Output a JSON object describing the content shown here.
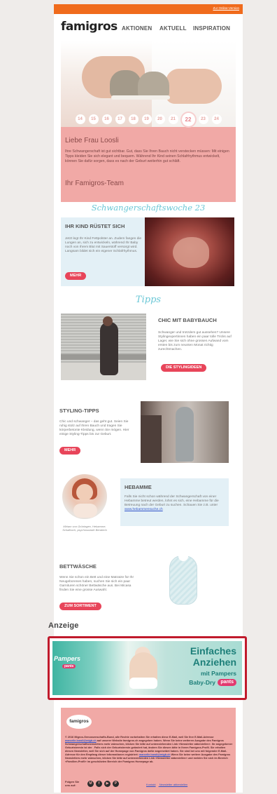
{
  "topbar": {
    "online_link": "Zur Online-Version"
  },
  "header": {
    "logo": "famigros",
    "nav": [
      "AKTIONEN",
      "AKTUELL",
      "INSPIRATION"
    ]
  },
  "hero": {
    "weeks": [
      "14",
      "15",
      "16",
      "17",
      "18",
      "19",
      "20",
      "21",
      "22",
      "23",
      "24"
    ],
    "greeting": "Liebe Frau Loosli",
    "text": "Ihre Schwangerschaft ist gut sichtbar. Gut, dass Sie Ihren Bauch nicht verstecken müssen: Mit einigen Tipps kleiden Sie sich elegant und bequem. Während Ihr Kind seinen Schlafrhythmus entwickelt, können Sie dafür sorgen, dass es nach der Geburt weiterhin gut schläft.",
    "signature": "Ihr Famigros-Team"
  },
  "week_heading": "Schwangerschaftswoche 23",
  "kind": {
    "title": "IHR KIND RÜSTET SICH",
    "text": "Jetzt legt Ihr Kind Fettpolster an. Zudem fangen die Lungen an, sich zu entwickeln, während Ihr Baby noch von Ihrem Blut mit Sauerstoff versorgt wird. Langsam bildet sich ein eigener Schlafrhythmus.",
    "button": "MEHR"
  },
  "tipps_heading": "Tipps",
  "chic": {
    "title": "CHIC MIT BABYBAUCH",
    "text": "Schwanger und trotzdem gut aussehen? Unsere Stylingexpertinnen haben ein paar tolle Tricks auf Lager, wie Sie sich ohne grossen Aufwand vom ersten bis zum neunten Monat richtig zurechtmachen.",
    "button": "DIE STYLINGIDEEN"
  },
  "styling": {
    "title": "STYLING-TIPPS",
    "text": "Chic und schwanger – das geht gut. Seien Sie ruhig stolz auf Ihren Bauch und tragen Sie körperbetonte Kleidung, wenn Sie mögen. Hier einige Styling-Tipps bis zur Geburt.",
    "button": "MEHR"
  },
  "hebamme": {
    "title": "HEBAMME",
    "text": "Falls Sie nicht schon während der Schwangerschaft von einer Hebamme betreut werden, lohnt es sich, eine Hebamme für die Betreuung nach der Geburt zu suchen. Schauen Sie z.B. unter",
    "link": "www.hebammensuche.ch",
    "caption": "Miriam von Grüningen, Hebamme, Schafbuch, psychosoziale Beraterin"
  },
  "bett": {
    "title": "BETTWÄSCHE",
    "text": "Wenn Sie schon ein Bett und eine Matratze für Ihr Neugeborenes haben, suchen Sie sich ein paar Garnituren schöner Bettwäsche aus. Bei Micasa finden Sie eine grosse Auswahl.",
    "button": "ZUM SORTIMENT"
  },
  "ad": {
    "label": "Anzeige",
    "brand": "Pampers",
    "brand_tag": "pants",
    "headline1": "Einfaches",
    "headline2": "Anziehen",
    "line3": "mit Pampers",
    "line4": "Baby-Dry",
    "pill": "pants"
  },
  "footer": {
    "logo": "famigros",
    "text_a": "© 2016 Migros-Genossenschafts-Bund, alle Rechte vorbehalten Sie erhalten diese E-Mail, weil Sie Ihre E-Mail-Adresse",
    "email": "marcelle.loosli@migb.ch",
    "text_b": "auf unserer Website famigros.ch angegeben haben. Wenn Sie keine weiteren Ausgabe des Famigros Schwangerschaftsnewsletters mehr wünschen, klicken Sie bitte auf untenstehenden Link «Newsletter abbestellen». Ihr angegebener Geburtstermin ist der . Falls sich der Geburtstermin geändert hat, ändern Sie diesen bitte in Ihrem Famigros-Profil. Sie erhalten diesen Newsletter, weil Sie sich auf der Homepage von Famigros dafür angemeldet haben. Sie sind bei uns mit folgender E-Mail-Adresse für den Empfang dieser Informationen registriert:",
    "email2": "marcelle.loosli@migb.ch",
    "text_c": "Wenn Sie keine weitere Ausgabe des Famigros Newsletters mehr wünschen, klicken Sie bitte auf untenstehenden Link «Newsletter abbestellen» und melden Sie sich im Bereich «Familien-Profil» im geschützten Bereich der Famigros Homepage ab.",
    "follow": "Folgen Sie uns auf:",
    "social": [
      "M",
      "f",
      "▶",
      "P"
    ],
    "links": [
      "Kontakt",
      "Newsletter abbestellen"
    ]
  }
}
